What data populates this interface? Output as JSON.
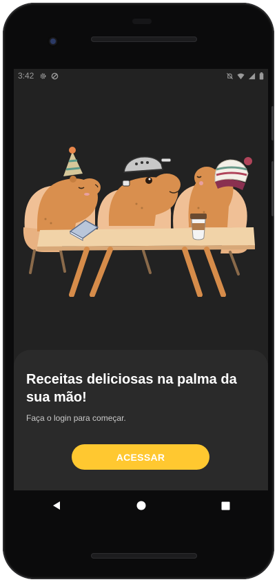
{
  "status_bar": {
    "time": "3:42"
  },
  "onboarding": {
    "title": "Receitas deliciosas na palma da sua mão!",
    "subtitle": "Faça o login para começar.",
    "button_label": "ACESSAR"
  },
  "icons": {
    "nav_back": "back-triangle-icon",
    "nav_home": "home-circle-icon",
    "nav_recents": "recents-square-icon"
  },
  "colors": {
    "screen_background": "#222222",
    "sheet_background": "#2a2a2a",
    "accent_button": "#ffc830",
    "capybara_fur": "#d98f4e",
    "chair": "#f0c096",
    "table_top": "#f1d3a8"
  }
}
